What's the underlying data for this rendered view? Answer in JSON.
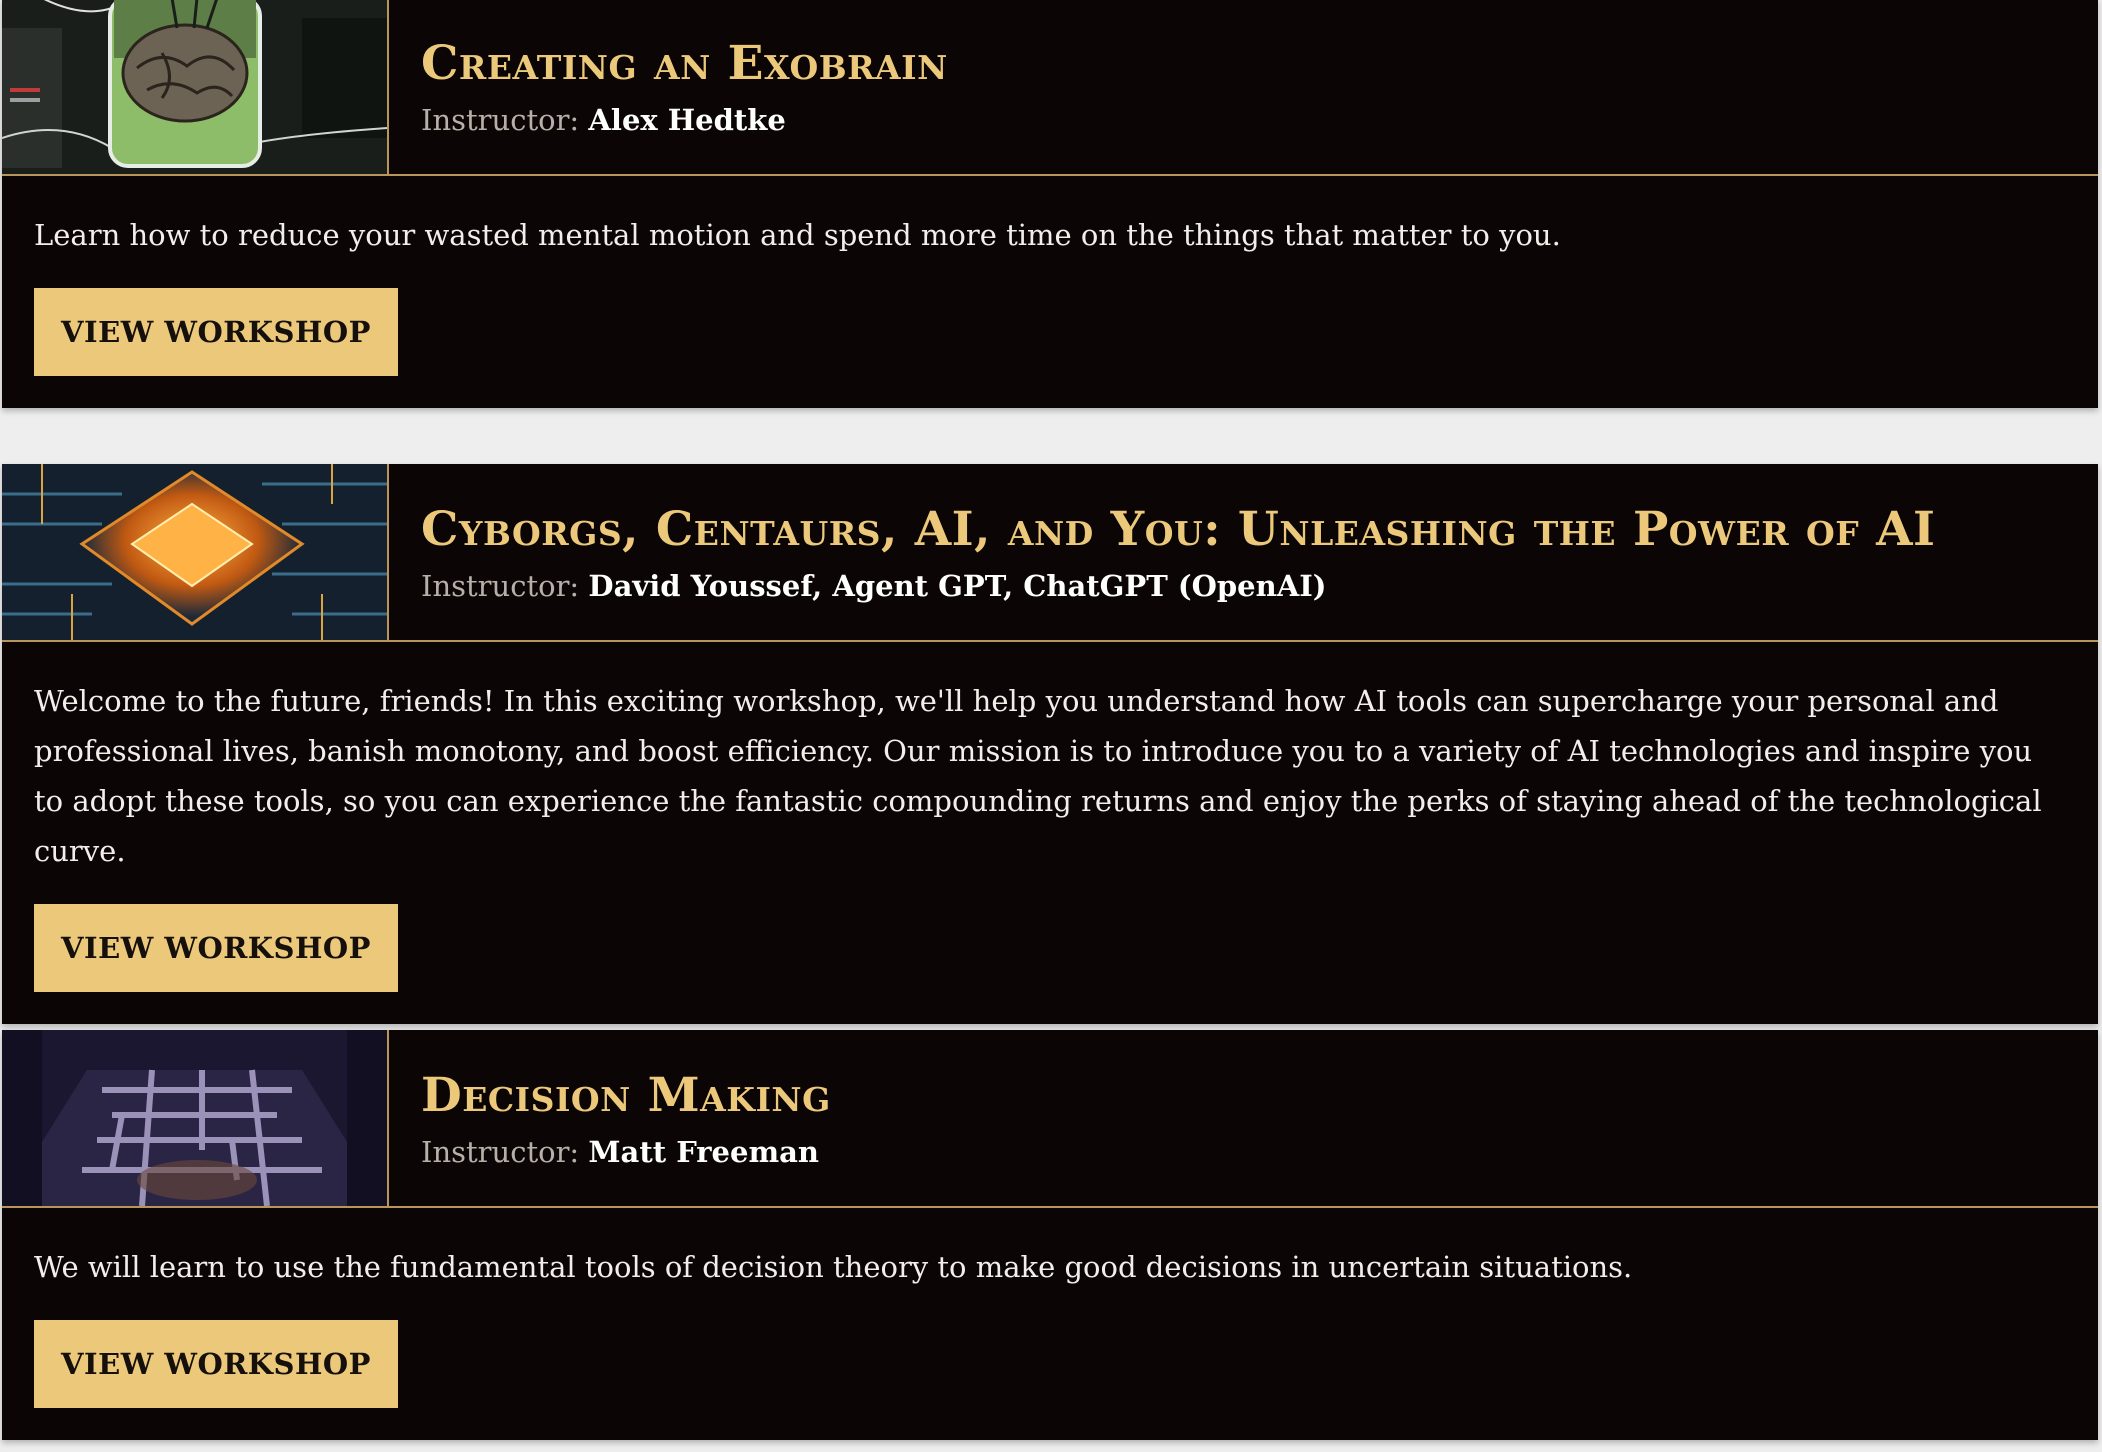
{
  "workshops": [
    {
      "title": "Creating an Exobrain",
      "instructor_label": "Instructor:",
      "instructor_name": "Alex Hedtke",
      "description": "Learn how to reduce your wasted mental motion and spend more time on the things that matter to you.",
      "button_label": "VIEW WORKSHOP",
      "thumbnail_icon": "brain-in-jar-icon"
    },
    {
      "title": "Cyborgs, Centaurs, AI, and You: Unleashing the Power of AI",
      "instructor_label": "Instructor:",
      "instructor_name": "David Youssef, Agent GPT, ChatGPT (OpenAI)",
      "description": "Welcome to the future, friends! In this exciting workshop, we'll help you understand how AI tools can supercharge your personal and professional lives, banish monotony, and boost efficiency. Our mission is to introduce you to a variety of AI technologies and inspire you to adopt these tools, so you can experience the fantastic compounding returns and enjoy the perks of staying ahead of the technological curve.",
      "button_label": "VIEW WORKSHOP",
      "thumbnail_icon": "circuit-chip-icon"
    },
    {
      "title": "Decision Making",
      "instructor_label": "Instructor:",
      "instructor_name": "Matt Freeman",
      "description": "We will learn to use the fundamental tools of decision theory to make good decisions in uncertain situations.",
      "button_label": "VIEW WORKSHOP",
      "thumbnail_icon": "maze-icon"
    }
  ],
  "colors": {
    "card_background": "#0b0506",
    "accent_gold": "#ecc97a",
    "border_gold": "#b89558",
    "page_background": "#eeeeee"
  }
}
